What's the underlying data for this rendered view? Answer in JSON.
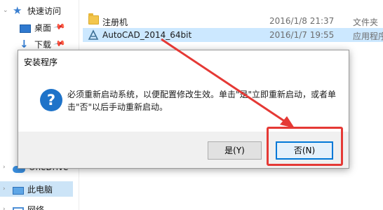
{
  "nav": {
    "items": [
      {
        "label": "快速访问",
        "icon": "star-icon"
      },
      {
        "label": "桌面",
        "icon": "desktop-icon"
      },
      {
        "label": "下载",
        "icon": "download-icon"
      },
      {
        "label": "OneDrive",
        "icon": "cloud-icon"
      },
      {
        "label": "此电脑",
        "icon": "computer-icon"
      },
      {
        "label": "网络",
        "icon": "network-icon"
      }
    ]
  },
  "files": [
    {
      "name": "注册机",
      "date": "2016/1/8 21:37",
      "type": "文件夹",
      "icon": "folder-icon"
    },
    {
      "name": "AutoCAD_2014_64bit",
      "date": "2016/1/7 19:55",
      "type": "应用程序",
      "icon": "autocad-icon"
    }
  ],
  "dialog": {
    "title": "安装程序",
    "message": "必须重新启动系统，以便配置修改生效。单击\"是\"立即重新启动，或者单击\"否\"以后手动重新启动。",
    "yes_label": "是(Y)",
    "no_label": "否(N)"
  },
  "colors": {
    "annotation": "#e53935",
    "accent": "#0078d7",
    "selection": "#cce8ff"
  }
}
